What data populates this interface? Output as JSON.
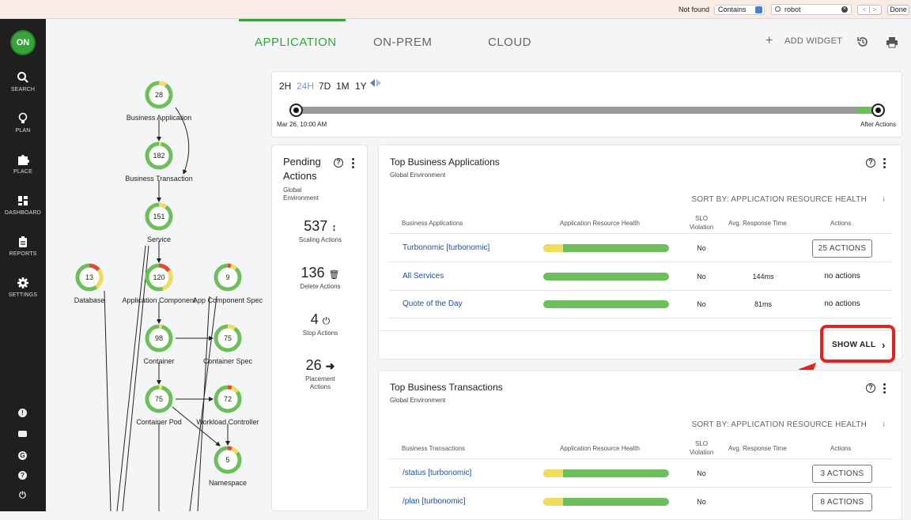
{
  "find_bar": {
    "status": "Not found",
    "match_mode": "Contains",
    "query": "robot",
    "prev_label": "<",
    "next_label": ">",
    "done_label": "Done"
  },
  "sidebar": {
    "logo_text": "ON",
    "items": [
      {
        "label": "SEARCH",
        "icon": "search-icon"
      },
      {
        "label": "PLAN",
        "icon": "bulb-icon"
      },
      {
        "label": "PLACE",
        "icon": "puzzle-icon"
      },
      {
        "label": "DASHBOARD",
        "icon": "grid-icon"
      },
      {
        "label": "REPORTS",
        "icon": "clipboard-icon"
      },
      {
        "label": "SETTINGS",
        "icon": "gear-icon"
      }
    ],
    "bottom_icons": [
      "alert-icon",
      "mail-icon",
      "g-icon",
      "help-icon",
      "power-icon"
    ]
  },
  "tabs": [
    {
      "label": "APPLICATION",
      "active": true
    },
    {
      "label": "ON-PREM",
      "active": false
    },
    {
      "label": "CLOUD",
      "active": false
    }
  ],
  "toolbar": {
    "add_widget": "ADD WIDGET"
  },
  "supply_chain": {
    "nodes": [
      {
        "id": "business-application",
        "label": "Business Application",
        "count": "28",
        "health": 0.9
      },
      {
        "id": "business-transaction",
        "label": "Business Transaction",
        "count": "182",
        "health": 0.97
      },
      {
        "id": "service",
        "label": "Service",
        "count": "151",
        "health": 0.9
      },
      {
        "id": "database",
        "label": "Database",
        "count": "13",
        "health": 0.6
      },
      {
        "id": "application-component",
        "label": "Application Component",
        "count": "120",
        "health": 0.55
      },
      {
        "id": "app-component-spec",
        "label": "App Component Spec",
        "count": "9",
        "health": 0.88
      },
      {
        "id": "container",
        "label": "Container",
        "count": "98",
        "health": 0.96
      },
      {
        "id": "container-spec",
        "label": "Container Spec",
        "count": "75",
        "health": 0.9
      },
      {
        "id": "container-pod",
        "label": "Container Pod",
        "count": "75",
        "health": 0.96
      },
      {
        "id": "workload-controller",
        "label": "Workload Controller",
        "count": "72",
        "health": 0.85
      },
      {
        "id": "namespace",
        "label": "Namespace",
        "count": "5",
        "health": 0.85
      }
    ]
  },
  "timeline": {
    "ranges": [
      "2H",
      "24H",
      "7D",
      "1M",
      "1Y"
    ],
    "selected_range": "24H",
    "start_label": "Mar 26, 10:00 AM",
    "end_label": "After Actions"
  },
  "pending": {
    "title_line1": "Pending",
    "title_line2": "Actions",
    "subtitle_line1": "Global",
    "subtitle_line2": "Environment",
    "stats": [
      {
        "value": "537",
        "label": "Scaling Actions",
        "icon": "scale-arrows-icon"
      },
      {
        "value": "136",
        "label": "Delete Actions",
        "icon": "trash-icon"
      },
      {
        "value": "4",
        "label": "Stop Actions",
        "icon": "power-icon"
      },
      {
        "value": "26",
        "label_line1": "Placement",
        "label_line2": "Actions",
        "icon": "arrow-right-icon"
      }
    ]
  },
  "top_apps": {
    "title": "Top Business Applications",
    "subtitle": "Global Environment",
    "sort_label": "SORT BY: APPLICATION RESOURCE HEALTH",
    "columns": [
      "Business Applications",
      "Application Resource Health",
      "SLO Violation",
      "Avg. Response Time",
      "Actions"
    ],
    "rows": [
      {
        "name": "Turbonomic [turbonomic]",
        "health_warning": 0.16,
        "slo": "No",
        "response": "",
        "actions": "25 ACTIONS",
        "is_button": true
      },
      {
        "name": "All Services",
        "health_warning": 0,
        "slo": "No",
        "response": "144ms",
        "actions": "no actions",
        "is_button": false
      },
      {
        "name": "Quote of the Day",
        "health_warning": 0,
        "slo": "No",
        "response": "81ms",
        "actions": "no actions",
        "is_button": false
      }
    ],
    "show_all": "SHOW ALL"
  },
  "top_transactions": {
    "title": "Top Business Transactions",
    "subtitle": "Global Environment",
    "sort_label": "SORT BY: APPLICATION RESOURCE HEALTH",
    "columns": [
      "Business Transactions",
      "Application Resource Health",
      "SLO Violation",
      "Avg. Response Time",
      "Actions"
    ],
    "rows": [
      {
        "name": "/status [turbonomic]",
        "health_warning": 0.16,
        "slo": "No",
        "response": "",
        "actions": "3 ACTIONS",
        "is_button": true
      },
      {
        "name": "/plan [turbonomic]",
        "health_warning": 0.16,
        "slo": "No",
        "response": "",
        "actions": "8 ACTIONS",
        "is_button": true
      }
    ]
  },
  "colors": {
    "brand_green": "#3aa03c",
    "health_green": "#6cbf5a",
    "health_yellow": "#f0dd5c",
    "health_red": "#e2493c",
    "link_blue": "#1d4e9a",
    "annotation_red": "#e8201a"
  }
}
